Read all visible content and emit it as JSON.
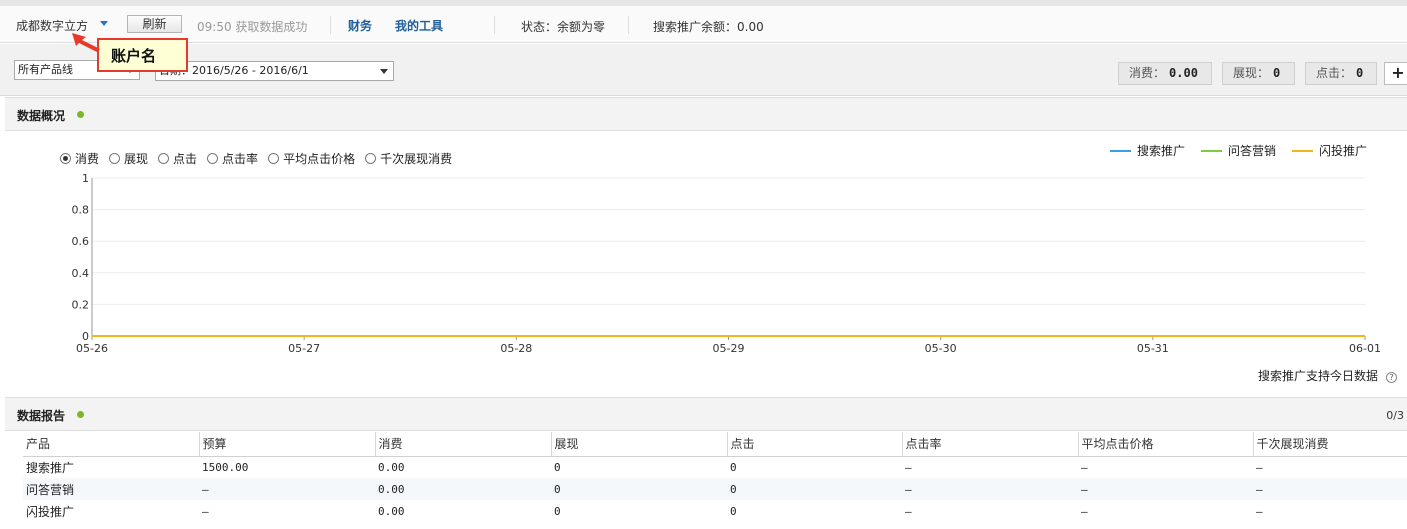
{
  "topbar": {
    "account_name": "成都数字立方",
    "refresh_label": "刷新",
    "status_message": "09:50 获取数据成功",
    "nav_finance": "财务",
    "nav_tools": "我的工具",
    "account_status": "状态：余额为零",
    "search_balance": "搜索推广余额：0.00"
  },
  "callout": {
    "label": "账户名"
  },
  "filters": {
    "product_line": "所有产品线",
    "date_range": "日期：2016/5/26 - 2016/6/1"
  },
  "summary": {
    "cost_label": "消费：",
    "cost_value": "0.00",
    "impressions_label": "展现：",
    "impressions_value": "0",
    "clicks_label": "点击：",
    "clicks_value": "0",
    "add_label": "+"
  },
  "overview": {
    "title": "数据概况",
    "metrics": [
      "消费",
      "展现",
      "点击",
      "点击率",
      "平均点击价格",
      "千次展现消费"
    ],
    "selected_metric": "消费",
    "footnote": "搜索推广支持今日数据",
    "help_icon": "?"
  },
  "chart_data": {
    "type": "line",
    "categories": [
      "05-26",
      "05-27",
      "05-28",
      "05-29",
      "05-30",
      "05-31",
      "06-01"
    ],
    "y_ticks": [
      "0",
      "0.2",
      "0.4",
      "0.6",
      "0.8",
      "1"
    ],
    "ylim": [
      0,
      1
    ],
    "grid": true,
    "legend_position": "top-right",
    "series": [
      {
        "name": "搜索推广",
        "color": "#3a9ee4",
        "values": [
          0,
          0,
          0,
          0,
          0,
          0,
          0
        ]
      },
      {
        "name": "问答营销",
        "color": "#7ccf3c",
        "values": [
          0,
          0,
          0,
          0,
          0,
          0,
          0
        ]
      },
      {
        "name": "闪投推广",
        "color": "#f2b51c",
        "values": [
          0,
          0,
          0,
          0,
          0,
          0,
          0
        ]
      }
    ]
  },
  "report": {
    "title": "数据报告",
    "pager": "0/3",
    "columns": [
      "产品",
      "预算",
      "消费",
      "展现",
      "点击",
      "点击率",
      "平均点击价格",
      "千次展现消费"
    ],
    "rows": [
      [
        "搜索推广",
        "1500.00",
        "0.00",
        "0",
        "0",
        "–",
        "–",
        "–"
      ],
      [
        "问答营销",
        "–",
        "0.00",
        "0",
        "0",
        "–",
        "–",
        "–"
      ],
      [
        "闪投推广",
        "–",
        "0.00",
        "0",
        "0",
        "–",
        "–",
        "–"
      ]
    ]
  }
}
